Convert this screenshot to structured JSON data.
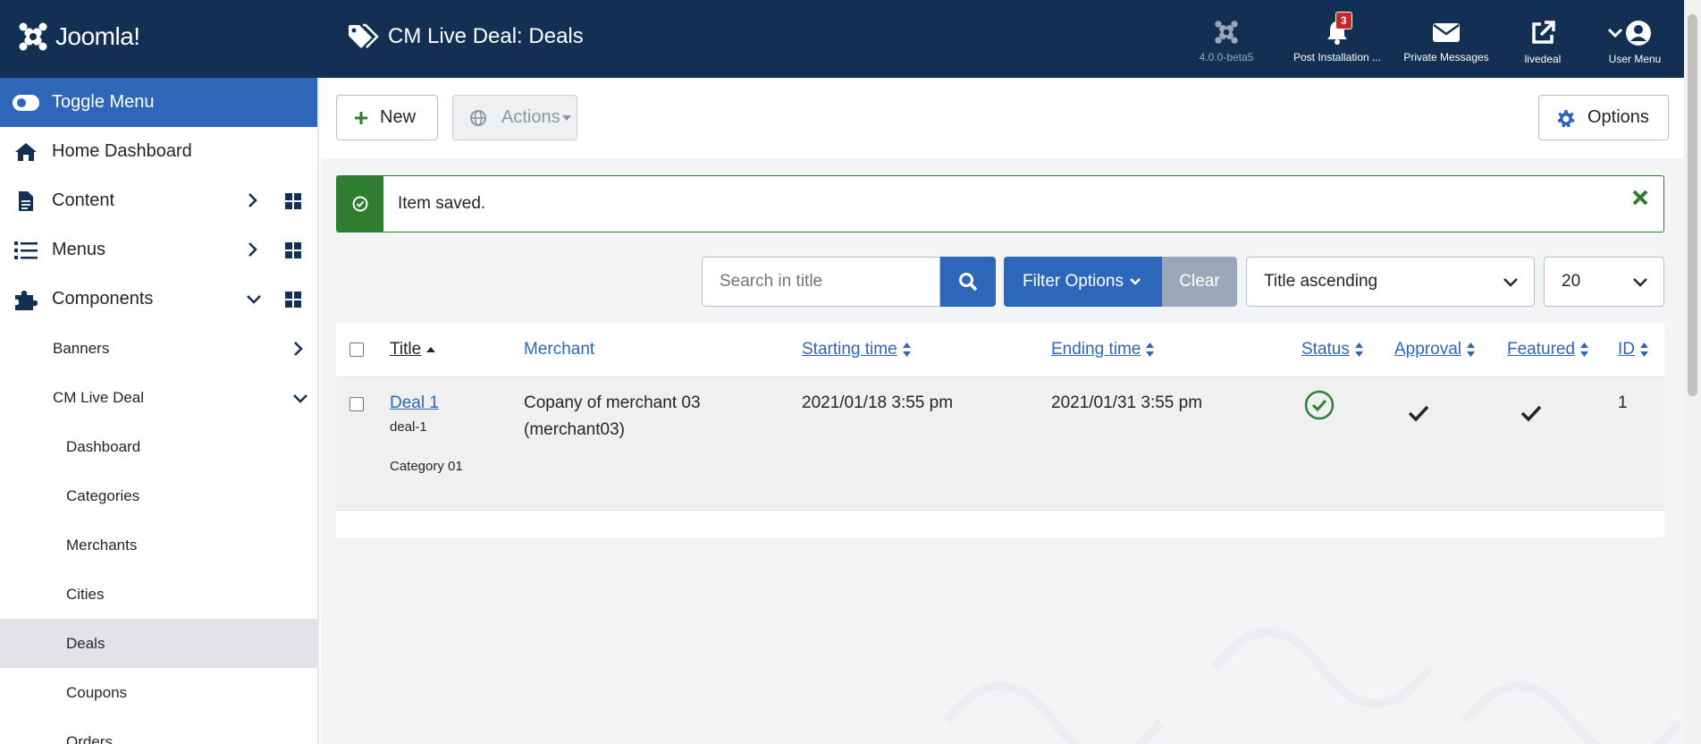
{
  "header": {
    "logo_text": "Joomla!",
    "page_title": "CM Live Deal: Deals",
    "items": [
      {
        "label": "4.0.0-beta5",
        "icon": "joomla-icon"
      },
      {
        "label": "Post Installation ...",
        "icon": "bell-icon",
        "badge": "3"
      },
      {
        "label": "Private Messages",
        "icon": "envelope-icon"
      },
      {
        "label": "livedeal",
        "icon": "external-link-icon"
      },
      {
        "label": "User Menu",
        "icon": "user-icon"
      }
    ]
  },
  "sidebar": {
    "toggle_label": "Toggle Menu",
    "items": [
      {
        "label": "Home Dashboard",
        "icon": "home-icon"
      },
      {
        "label": "Content",
        "icon": "file-icon"
      },
      {
        "label": "Menus",
        "icon": "list-icon"
      },
      {
        "label": "Components",
        "icon": "puzzle-icon"
      }
    ],
    "components_sub": [
      {
        "label": "Banners"
      },
      {
        "label": "CM Live Deal"
      }
    ],
    "livedeal_sub": [
      {
        "label": "Dashboard"
      },
      {
        "label": "Categories"
      },
      {
        "label": "Merchants"
      },
      {
        "label": "Cities"
      },
      {
        "label": "Deals",
        "active": true
      },
      {
        "label": "Coupons"
      },
      {
        "label": "Orders"
      }
    ]
  },
  "toolbar": {
    "new_label": "New",
    "actions_label": "Actions",
    "options_label": "Options"
  },
  "alert": {
    "message": "Item saved."
  },
  "filters": {
    "search_placeholder": "Search in title",
    "filter_options_label": "Filter Options",
    "clear_label": "Clear",
    "sort_value": "Title ascending",
    "limit_value": "20"
  },
  "table": {
    "headers": {
      "title": "Title",
      "merchant": "Merchant",
      "starting_time": "Starting time",
      "ending_time": "Ending time",
      "status": "Status",
      "approval": "Approval",
      "featured": "Featured",
      "id": "ID"
    },
    "rows": [
      {
        "title": "Deal 1",
        "alias": "deal-1",
        "category": "Category 01",
        "merchant_line1": "Copany of merchant 03",
        "merchant_line2": "(merchant03)",
        "starting_time": "2021/01/18 3:55 pm",
        "ending_time": "2021/01/31 3:55 pm",
        "status": "published",
        "approval": "approved",
        "featured": "featured",
        "id": "1"
      }
    ]
  },
  "colors": {
    "header_bg": "#132f53",
    "primary": "#2e67b9",
    "success": "#2f7d31",
    "badge": "#c52827"
  }
}
